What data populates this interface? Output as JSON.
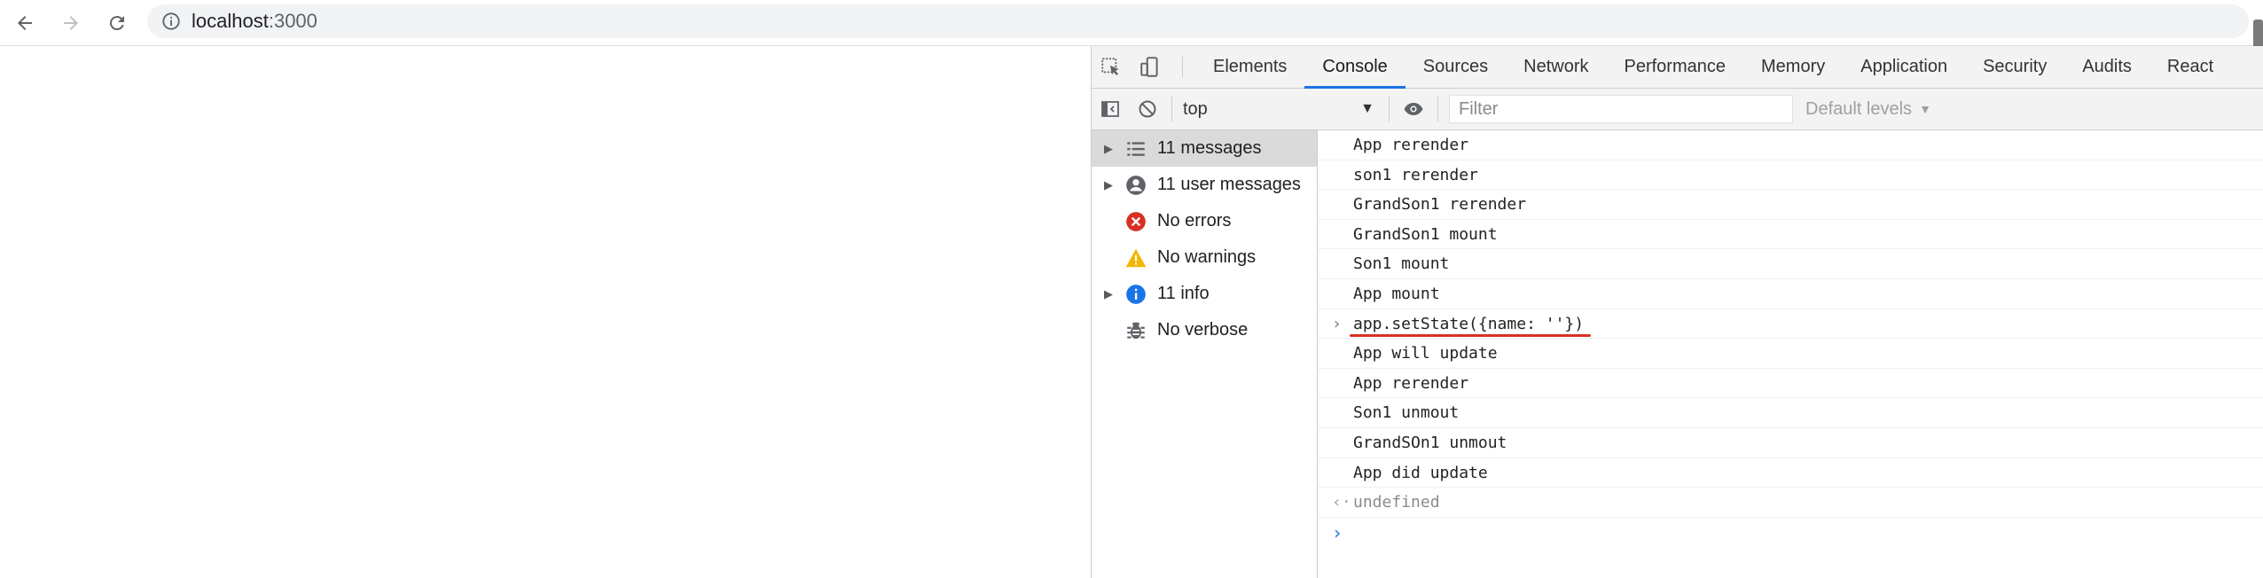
{
  "browser": {
    "url_host": "localhost",
    "url_port": ":3000"
  },
  "devtools": {
    "tabs": [
      "Elements",
      "Console",
      "Sources",
      "Network",
      "Performance",
      "Memory",
      "Application",
      "Security",
      "Audits",
      "React"
    ],
    "active_tab": "Console",
    "toolbar": {
      "context": "top",
      "filter_placeholder": "Filter",
      "levels": "Default levels"
    },
    "sidebar": {
      "items": [
        {
          "label": "11 messages",
          "icon": "list-icon",
          "expandable": true,
          "selected": true
        },
        {
          "label": "11 user messages",
          "icon": "user-icon",
          "expandable": true,
          "selected": false
        },
        {
          "label": "No errors",
          "icon": "error-icon",
          "expandable": false,
          "selected": false
        },
        {
          "label": "No warnings",
          "icon": "warning-icon",
          "expandable": false,
          "selected": false
        },
        {
          "label": "11 info",
          "icon": "info-icon",
          "expandable": true,
          "selected": false
        },
        {
          "label": "No verbose",
          "icon": "bug-icon",
          "expandable": false,
          "selected": false
        }
      ]
    },
    "console": {
      "messages": [
        {
          "text": "App rerender",
          "kind": "log"
        },
        {
          "text": "son1 rerender",
          "kind": "log"
        },
        {
          "text": "GrandSon1 rerender",
          "kind": "log"
        },
        {
          "text": "GrandSon1 mount",
          "kind": "log"
        },
        {
          "text": "Son1 mount",
          "kind": "log"
        },
        {
          "text": "App mount",
          "kind": "log"
        },
        {
          "text": "app.setState({name: ''})",
          "kind": "input"
        },
        {
          "text": "App will update",
          "kind": "log"
        },
        {
          "text": "App rerender",
          "kind": "log"
        },
        {
          "text": "Son1 unmout",
          "kind": "log"
        },
        {
          "text": "GrandSOn1 unmout",
          "kind": "log"
        },
        {
          "text": "App did update",
          "kind": "log"
        },
        {
          "text": "undefined",
          "kind": "result"
        }
      ]
    }
  },
  "colors": {
    "accent": "#1a73e8",
    "error": "#d93025",
    "warning": "#f2b600",
    "info": "#1a73e8"
  }
}
